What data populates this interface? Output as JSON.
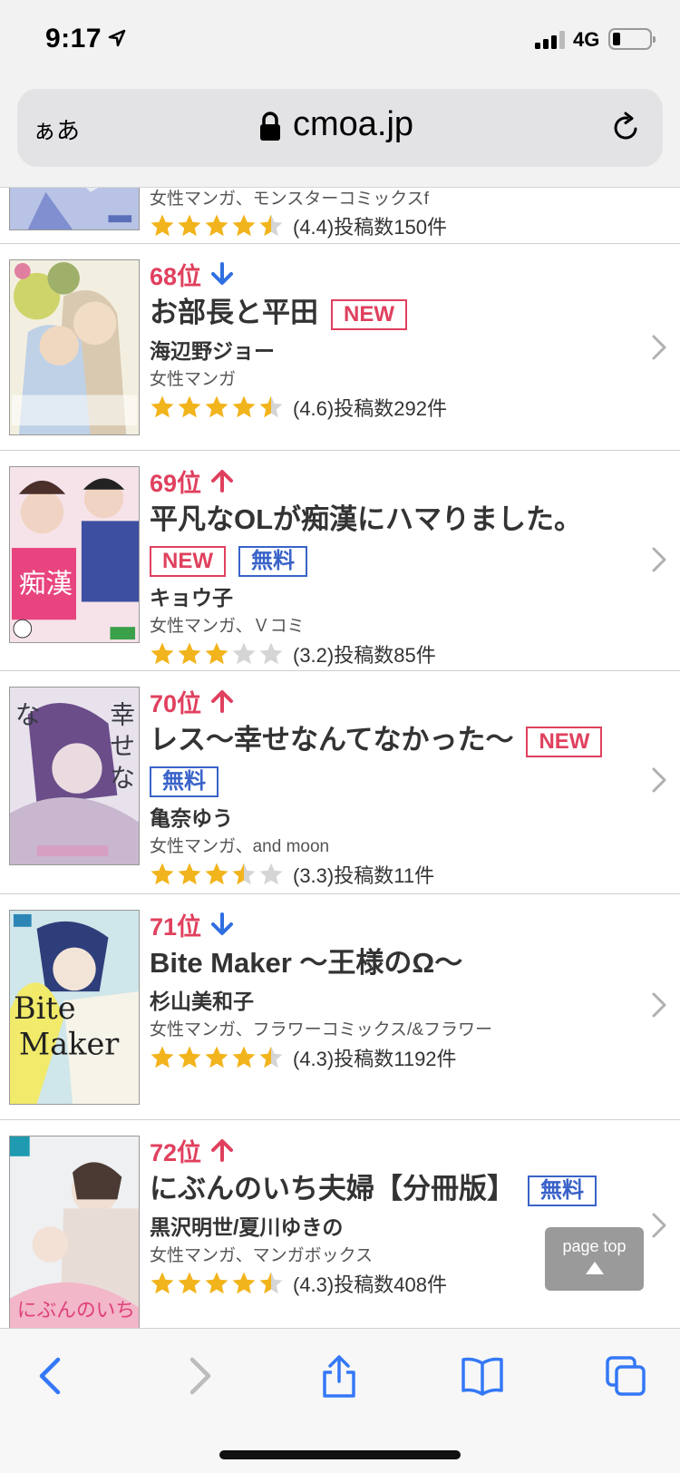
{
  "status_bar": {
    "time": "9:17",
    "network": "4G",
    "battery_level": 0.2
  },
  "address_bar": {
    "text_size_label": "ぁあ",
    "host": "cmoa.jp"
  },
  "items": [
    {
      "genre": "女性マンガ、モンスターコミックスf",
      "rating_value": 4.4,
      "rating_text": "(4.4)投稿数150件"
    },
    {
      "rank": "68位",
      "trend": "down",
      "title": "お部長と平田",
      "badges": [
        "NEW"
      ],
      "author": "海辺野ジョー",
      "genre": "女性マンガ",
      "rating_value": 4.6,
      "rating_text": "(4.6)投稿数292件"
    },
    {
      "rank": "69位",
      "trend": "up",
      "title": "平凡なOLが痴漢にハマりました。",
      "badges": [
        "NEW",
        "無料"
      ],
      "author": "キョウ子",
      "genre": "女性マンガ、Ｖコミ",
      "rating_value": 3.2,
      "rating_text": "(3.2)投稿数85件"
    },
    {
      "rank": "70位",
      "trend": "up",
      "title": "レス〜幸せなんてなかった〜",
      "badges": [
        "NEW",
        "無料"
      ],
      "author": "亀奈ゆう",
      "genre": "女性マンガ、and moon",
      "rating_value": 3.3,
      "rating_text": "(3.3)投稿数11件"
    },
    {
      "rank": "71位",
      "trend": "down",
      "title": "Bite Maker 〜王様のΩ〜",
      "badges": [],
      "author": "杉山美和子",
      "genre": "女性マンガ、フラワーコミックス/&フラワー",
      "rating_value": 4.3,
      "rating_text": "(4.3)投稿数1192件"
    },
    {
      "rank": "72位",
      "trend": "up",
      "title": "にぶんのいち夫婦【分冊版】",
      "badges": [
        "無料"
      ],
      "author": "黒沢明世/夏川ゆきの",
      "genre": "女性マンガ、マンガボックス",
      "rating_value": 4.3,
      "rating_text": "(4.3)投稿数408件"
    }
  ],
  "page_top": {
    "label": "page top"
  },
  "colors": {
    "rank": "#e0405e",
    "trend_up": "#e0405e",
    "trend_down": "#2f6fe0",
    "new_badge": "#e0405e",
    "free_badge": "#3a63c9",
    "star": "#f2b41c",
    "star_empty": "#d5d5d5",
    "toolbar_icon": "#3478f6"
  },
  "icons": {
    "status": [
      "location-arrow-icon",
      "signal-icon",
      "battery-icon"
    ],
    "address": [
      "lock-icon",
      "reload-icon"
    ],
    "toolbar": [
      "back-icon",
      "forward-icon",
      "share-icon",
      "bookmarks-icon",
      "tabs-icon"
    ]
  }
}
